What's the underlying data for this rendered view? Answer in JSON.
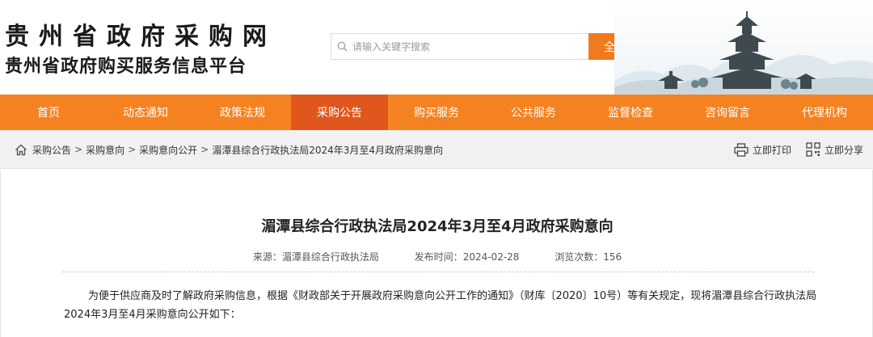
{
  "header": {
    "site_title": "贵州省政府采购网",
    "site_subtitle": "贵州省政府购买服务信息平台",
    "search": {
      "placeholder": "请输入关键字搜索",
      "value": "",
      "button_label": "全站搜索"
    }
  },
  "nav": {
    "items": [
      {
        "label": "首页",
        "active": false
      },
      {
        "label": "动态通知",
        "active": false
      },
      {
        "label": "政策法规",
        "active": false
      },
      {
        "label": "采购公告",
        "active": true
      },
      {
        "label": "购买服务",
        "active": false
      },
      {
        "label": "公共服务",
        "active": false
      },
      {
        "label": "监督检查",
        "active": false
      },
      {
        "label": "咨询留言",
        "active": false
      },
      {
        "label": "代理机构",
        "active": false
      }
    ]
  },
  "breadcrumb": {
    "items": [
      "采购公告",
      "采购意向",
      "采购意向公开",
      "湄潭县综合行政执法局2024年3月至4月政府采购意向"
    ],
    "separator": ">"
  },
  "tools": {
    "print_label": "立即打印",
    "share_label": "立即分享"
  },
  "article": {
    "title": "湄潭县综合行政执法局2024年3月至4月政府采购意向",
    "source_label": "来源：",
    "source": "湄潭县综合行政执法局",
    "date_label": "发布时间：",
    "date": "2024-02-28",
    "views_label": "浏览次数：",
    "views": "156",
    "paragraph": "为便于供应商及时了解政府采购信息，根据《财政部关于开展政府采购意向公开工作的通知》（财库〔2020〕10号）等有关规定，现将湄潭县综合行政执法局2024年3月至4月采购意向公开如下："
  },
  "colors": {
    "nav_bg": "#f58220",
    "nav_active": "#e0561c",
    "search_button": "#f07a1e"
  }
}
